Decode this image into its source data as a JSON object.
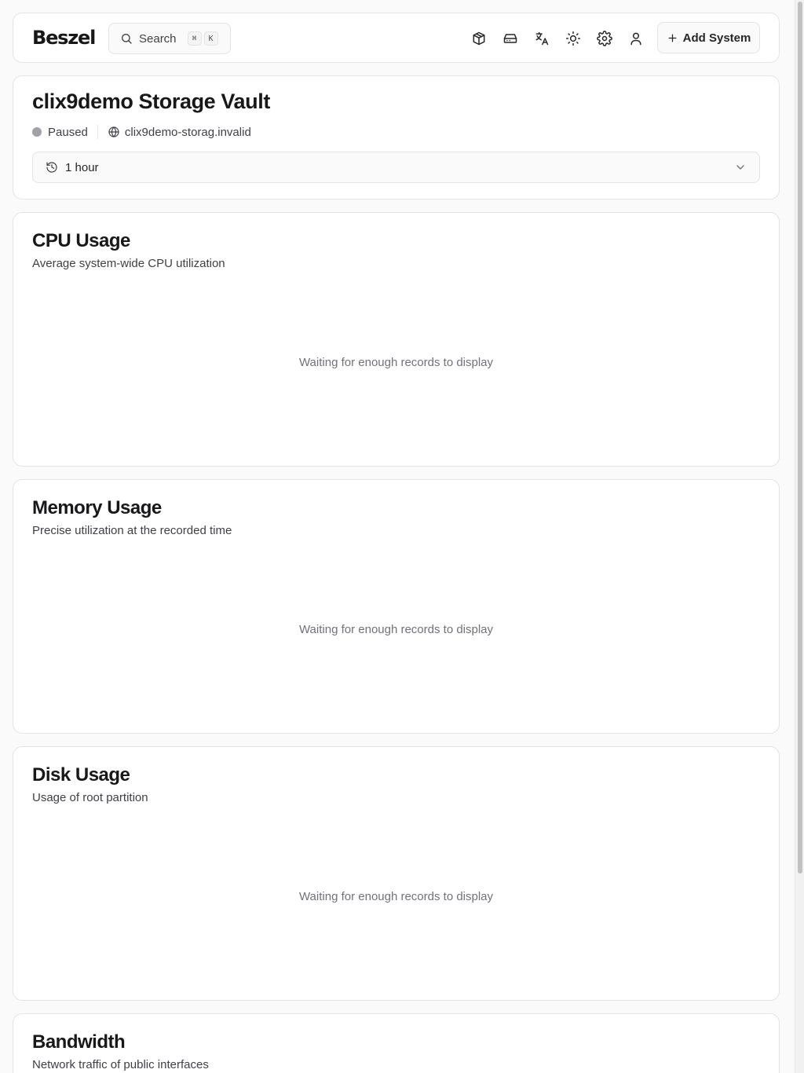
{
  "header": {
    "logo": "Beszel",
    "search": {
      "label": "Search",
      "shortcut_keys": [
        "⌘",
        "K"
      ]
    },
    "toolbar_icons": [
      "containers-icon",
      "storage-icon",
      "language-icon",
      "theme-icon",
      "settings-icon",
      "user-icon"
    ],
    "add_system_label": "Add System"
  },
  "system": {
    "name": "clix9demo Storage Vault",
    "status": "Paused",
    "status_color": "#a1a1aa",
    "host": "clix9demo-storag.invalid",
    "time_range": "1 hour"
  },
  "charts": [
    {
      "title": "CPU Usage",
      "description": "Average system-wide CPU utilization",
      "empty_text": "Waiting for enough records to display"
    },
    {
      "title": "Memory Usage",
      "description": "Precise utilization at the recorded time",
      "empty_text": "Waiting for enough records to display"
    },
    {
      "title": "Disk Usage",
      "description": "Usage of root partition",
      "empty_text": "Waiting for enough records to display"
    },
    {
      "title": "Bandwidth",
      "description": "Network traffic of public interfaces",
      "empty_text": ""
    }
  ]
}
